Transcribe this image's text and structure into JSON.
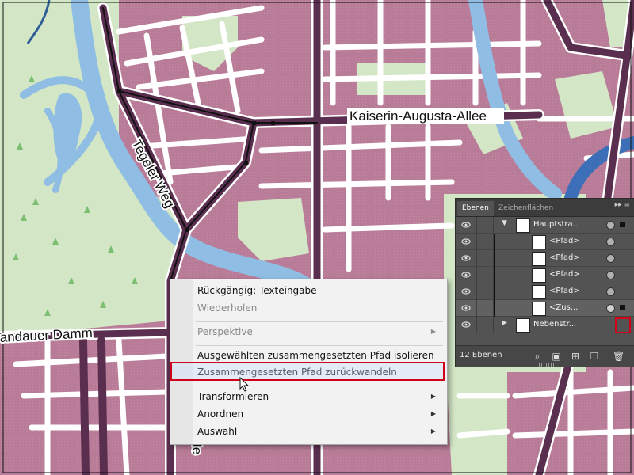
{
  "map": {
    "street_labels": {
      "kaiserin": "Kaiserin-Augusta-Allee",
      "tegeler": "Tegeler Weg",
      "spandauer": "andauer Damm",
      "bottom": "Ie"
    },
    "colors": {
      "park": "#cfe3c3",
      "block": "#b97c98",
      "road_fill": "#5a2e4f",
      "water": "#8fbde3",
      "river_blue": "#3d6fb8"
    }
  },
  "context_menu": {
    "items": [
      {
        "label": "Rückgängig: Texteingabe",
        "disabled": false,
        "submenu": false
      },
      {
        "label": "Wiederholen",
        "disabled": true,
        "submenu": false
      },
      {
        "label": "Perspektive",
        "disabled": true,
        "submenu": true
      },
      {
        "label": "Ausgewählten zusammengesetzten Pfad isolieren",
        "disabled": false,
        "submenu": false
      },
      {
        "label": "Zusammengesetzten Pfad zurückwandeln",
        "disabled": false,
        "submenu": false,
        "highlighted": true
      },
      {
        "label": "Transformieren",
        "disabled": false,
        "submenu": true
      },
      {
        "label": "Anordnen",
        "disabled": false,
        "submenu": true
      },
      {
        "label": "Auswahl",
        "disabled": false,
        "submenu": true
      }
    ],
    "highlight_color": "#d0021b"
  },
  "layers_panel": {
    "tabs": [
      "Ebenen",
      "Zeichenflächen"
    ],
    "menu_glyph": "▸▸ ≡",
    "rows": [
      {
        "name": "Hauptstra...",
        "expanded": true
      },
      {
        "name": "<Pfad>"
      },
      {
        "name": "<Pfad>"
      },
      {
        "name": "<Pfad>"
      },
      {
        "name": "<Pfad>"
      },
      {
        "name": "<Zus..."
      },
      {
        "name": "Nebenstr..."
      }
    ],
    "layer_count": "12 Ebenen"
  }
}
